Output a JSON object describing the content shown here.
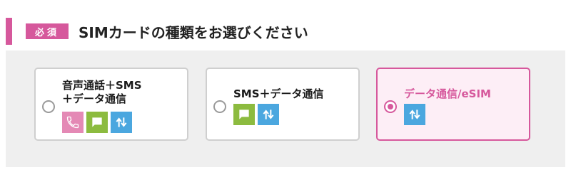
{
  "header": {
    "badge": "必須",
    "title": "SIMカードの種類をお選びください"
  },
  "options": [
    {
      "label_line1": "音声通話＋SMS",
      "label_line2": "＋データ通信",
      "selected": false,
      "icons": [
        "phone-icon",
        "sms-icon",
        "data-icon"
      ]
    },
    {
      "label_line1": "SMS＋データ通信",
      "selected": false,
      "icons": [
        "sms-icon",
        "data-icon"
      ]
    },
    {
      "label_line1": "データ通信/eSIM",
      "selected": true,
      "icons": [
        "data-icon"
      ]
    }
  ],
  "colors": {
    "accent": "#d6589c",
    "phone_icon": "#e489b5",
    "sms_icon": "#8cbb3f",
    "data_icon": "#4ba7df",
    "panel_bg": "#efefef"
  }
}
